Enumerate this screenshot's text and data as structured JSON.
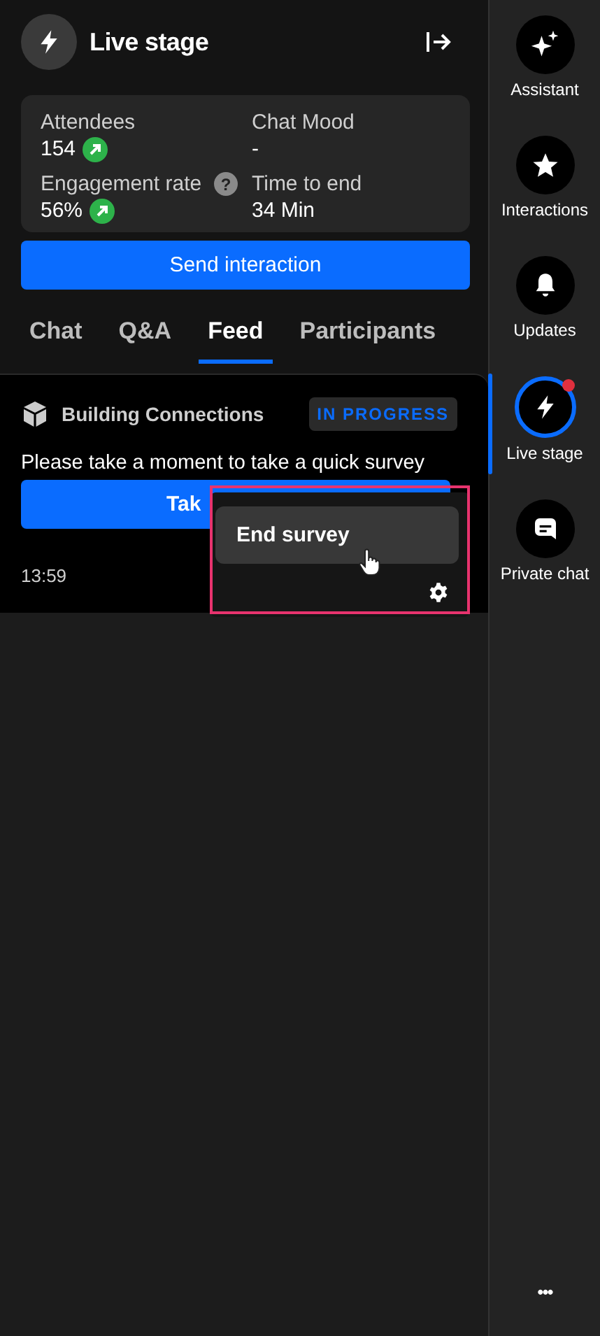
{
  "header": {
    "title": "Live stage"
  },
  "stats": [
    {
      "label": "Attendees",
      "value": "154",
      "trend_up": true
    },
    {
      "label": "Chat Mood",
      "value": "-",
      "trend_up": false
    },
    {
      "label": "Engagement rate",
      "value": "56%",
      "trend_up": true,
      "help": "?"
    },
    {
      "label": "Time to end",
      "value": "34 Min",
      "trend_up": false
    }
  ],
  "send_button": "Send interaction",
  "tabs": [
    {
      "label": "Chat",
      "selected": false
    },
    {
      "label": "Q&A",
      "selected": false
    },
    {
      "label": "Feed",
      "selected": true
    },
    {
      "label": "Participants",
      "selected": false
    }
  ],
  "feed_card": {
    "title": "Building Connections",
    "status": "IN PROGRESS",
    "message": "Please take a moment to take a quick survey",
    "button": "Tak",
    "time": "13:59"
  },
  "context_menu": {
    "items": [
      {
        "label": "End survey",
        "hovered": true
      }
    ]
  },
  "nav": [
    {
      "label": "Assistant",
      "selected": false,
      "badge": false
    },
    {
      "label": "Interactions",
      "selected": false,
      "badge": false
    },
    {
      "label": "Updates",
      "selected": false,
      "badge": false
    },
    {
      "label": "Live stage",
      "selected": true,
      "badge": true
    },
    {
      "label": "Private chat",
      "selected": false,
      "badge": false
    }
  ],
  "more_button": "•••"
}
